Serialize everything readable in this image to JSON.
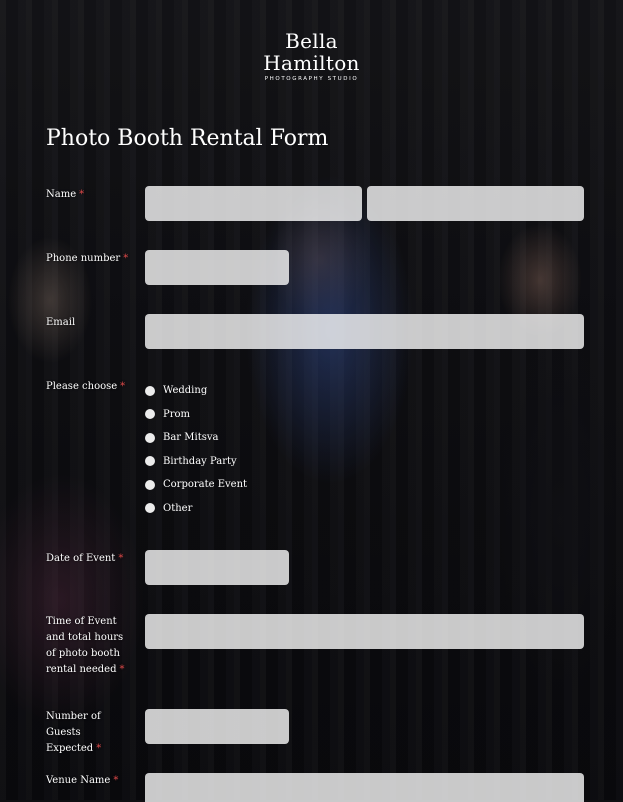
{
  "brand": {
    "line1": "Bella",
    "line2": "Hamilton",
    "tagline": "PHOTOGRAPHY STUDIO"
  },
  "form": {
    "title": "Photo Booth Rental Form",
    "fields": {
      "name": {
        "label": "Name",
        "required_mark": "*"
      },
      "phone": {
        "label": "Phone number",
        "required_mark": "*"
      },
      "email": {
        "label": "Email",
        "required_mark": ""
      },
      "choice": {
        "label": "Please choose",
        "required_mark": "*",
        "options": [
          "Wedding",
          "Prom",
          "Bar Mitsva",
          "Birthday Party",
          "Corporate Event",
          "Other"
        ]
      },
      "date": {
        "label": "Date of Event",
        "required_mark": "*"
      },
      "time": {
        "label": "Time of Event and total hours of photo booth rental needed",
        "required_mark": "*"
      },
      "guests": {
        "label": "Number of Guests Expected",
        "required_mark": "*"
      },
      "venue": {
        "label": "Venue Name",
        "required_mark": "*"
      }
    }
  }
}
